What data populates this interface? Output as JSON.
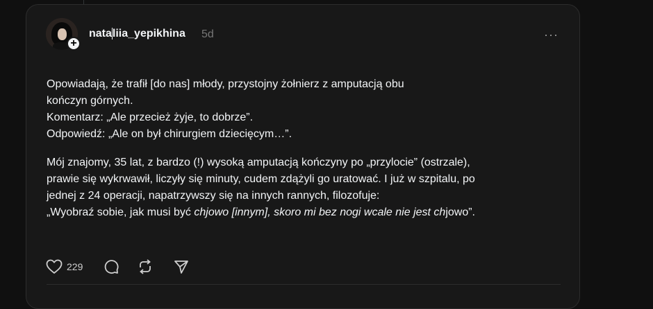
{
  "post": {
    "username_part1": "nata",
    "username_part2": "liia_yepikhina",
    "time": "5d",
    "more_label": "···",
    "follow_symbol": "+",
    "para1_lines": [
      "Opowiadają, że trafił [do nas] młody, przystojny żołnierz z amputacją obu",
      "kończyn górnych.",
      "Komentarz: „Ale przecież żyje, to dobrze”.",
      "Odpowiedź: „Ale on był chirurgiem dziecięcym…”."
    ],
    "para2_lines": [
      "Mój znajomy, 35 lat, z bardzo (!) wysoką amputacją kończyny po „przylocie” (ostrzale),",
      "prawie się wykrwawił, liczyły się minuty, cudem zdążyli go uratować. I już w szpitalu, po",
      "jednej z 24 operacji, napatrzywszy się na innych rannych, filozofuje:"
    ],
    "para2_last": {
      "a": "„Wyobraź sobie, jak musi być ",
      "b": "chjowo [innym], skoro mi bez nogi wcale nie jest ch",
      "c": "jowo”."
    },
    "likes": "229"
  },
  "colors": {
    "background": "#101010",
    "card": "#181818",
    "text": "#f3f5f7",
    "muted": "#777777"
  },
  "icons": [
    "heart-icon",
    "comment-icon",
    "repost-icon",
    "share-icon",
    "more-icon",
    "follow-plus-icon"
  ]
}
